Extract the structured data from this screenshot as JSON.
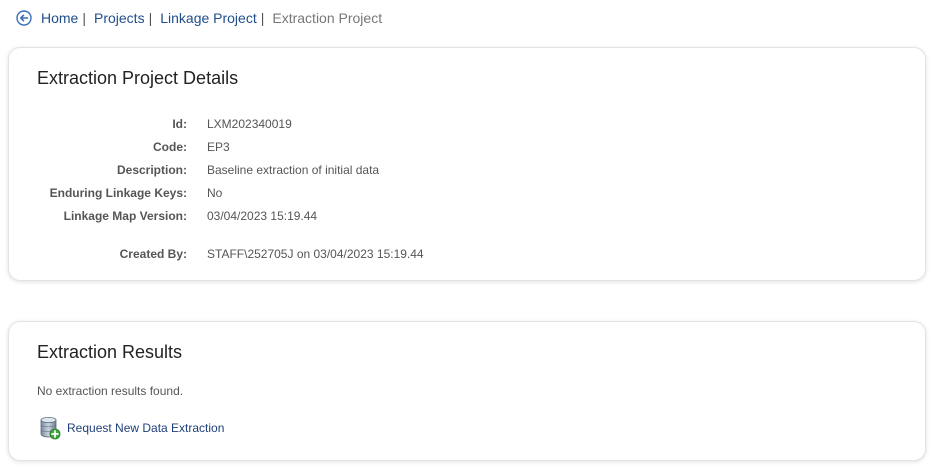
{
  "breadcrumb": {
    "items": [
      {
        "label": "Home",
        "sep": "|"
      },
      {
        "label": "Projects",
        "sep": "|"
      },
      {
        "label": "Linkage Project",
        "sep": "|"
      }
    ],
    "current": "Extraction Project"
  },
  "details": {
    "title": "Extraction Project Details",
    "fields": [
      {
        "label": "Id:",
        "value": "LXM202340019"
      },
      {
        "label": "Code:",
        "value": "EP3"
      },
      {
        "label": "Description:",
        "value": "Baseline extraction of initial data"
      },
      {
        "label": "Enduring Linkage Keys:",
        "value": "No"
      },
      {
        "label": "Linkage Map Version:",
        "value": "03/04/2023 15:19.44"
      },
      {
        "label": "Created By:",
        "value": "STAFF\\252705J on 03/04/2023 15:19.44"
      }
    ]
  },
  "results": {
    "title": "Extraction Results",
    "empty_message": "No extraction results found.",
    "request_label": "Request New Data Extraction"
  },
  "colors": {
    "link": "#1f4e8c",
    "muted": "#777777",
    "text": "#555555"
  },
  "icons": {
    "back": "back-arrow-circle-icon",
    "request": "database-add-icon"
  }
}
